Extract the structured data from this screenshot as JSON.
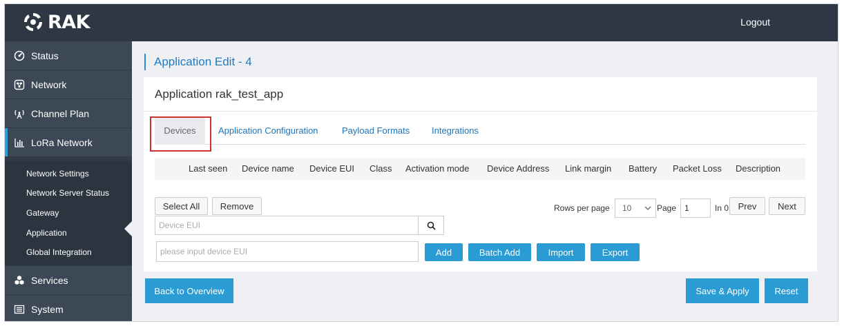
{
  "header": {
    "brand": "RAK",
    "logout_label": "Logout"
  },
  "sidebar": {
    "items": [
      {
        "label": "Status",
        "icon": "gauge-icon"
      },
      {
        "label": "Network",
        "icon": "network-icon"
      },
      {
        "label": "Channel Plan",
        "icon": "antenna-icon"
      },
      {
        "label": "LoRa Network",
        "icon": "bar-chart-icon"
      },
      {
        "label": "Services",
        "icon": "cubes-icon"
      },
      {
        "label": "System",
        "icon": "keyboard-icon"
      }
    ],
    "subitems": [
      {
        "label": "Network Settings"
      },
      {
        "label": "Network Server Status"
      },
      {
        "label": "Gateway"
      },
      {
        "label": "Application"
      },
      {
        "label": "Global Integration"
      }
    ],
    "active_item": "LoRa Network",
    "active_subitem": "Application"
  },
  "page": {
    "title": "Application Edit - 4"
  },
  "panel": {
    "title": "Application rak_test_app",
    "tabs": [
      {
        "label": "Devices"
      },
      {
        "label": "Application Configuration"
      },
      {
        "label": "Payload Formats"
      },
      {
        "label": "Integrations"
      }
    ],
    "active_tab": "Devices",
    "table": {
      "columns": [
        "Last seen",
        "Device name",
        "Device EUI",
        "Class",
        "Activation mode",
        "Device Address",
        "Link margin",
        "Battery",
        "Packet Loss",
        "Description"
      ]
    },
    "controls": {
      "select_all_label": "Select All",
      "remove_label": "Remove",
      "search_placeholder": "Device EUI",
      "rows_per_page_label": "Rows per page",
      "rows_per_page_value": "10",
      "page_label": "Page",
      "page_value": "1",
      "in_label": "In 0",
      "prev_label": "Prev",
      "next_label": "Next",
      "device_eui_placeholder": "please input device EUI",
      "add_label": "Add",
      "batch_add_label": "Batch Add",
      "import_label": "Import",
      "export_label": "Export"
    }
  },
  "footer": {
    "back_label": "Back to Overview",
    "save_label": "Save & Apply",
    "reset_label": "Reset"
  },
  "colors": {
    "header_bg": "#2e3845",
    "sidebar_bg": "#323c48",
    "accent": "#2b9bd4",
    "link": "#1f73b7",
    "highlight_box": "#d0312d"
  }
}
